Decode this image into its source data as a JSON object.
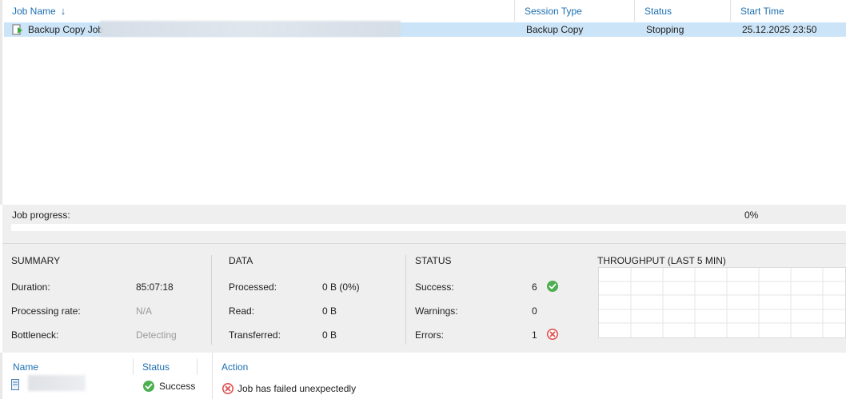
{
  "grid": {
    "columns": {
      "job_name": "Job Name",
      "session_type": "Session Type",
      "status": "Status",
      "start_time": "Start Time"
    },
    "sort_icon": "arrow-down-icon",
    "rows": [
      {
        "icon": "backup-copy-job-icon",
        "job_name": "Backup Copy Job",
        "session_type": "Backup Copy",
        "status": "Stopping",
        "start_time": "25.12.2025 23:50"
      }
    ]
  },
  "progress": {
    "label": "Job progress:",
    "percent_text": "0%",
    "value": 0,
    "color": "#3a9a3a"
  },
  "summary": {
    "title": "SUMMARY",
    "duration_label": "Duration:",
    "duration_value": "85:07:18",
    "rate_label": "Processing rate:",
    "rate_value": "N/A",
    "bottleneck_label": "Bottleneck:",
    "bottleneck_value": "Detecting"
  },
  "data": {
    "title": "DATA",
    "processed_label": "Processed:",
    "processed_value": "0 B (0%)",
    "read_label": "Read:",
    "read_value": "0 B",
    "transferred_label": "Transferred:",
    "transferred_value": "0 B"
  },
  "status": {
    "title": "STATUS",
    "success_label": "Success:",
    "success_value": "6",
    "success_icon": "success-check-icon",
    "warnings_label": "Warnings:",
    "warnings_value": "0",
    "errors_label": "Errors:",
    "errors_value": "1",
    "errors_icon": "error-x-icon",
    "success_color": "#4caf50",
    "error_color": "#e05050"
  },
  "throughput": {
    "title": "THROUGHPUT (LAST 5 MIN)"
  },
  "objects": {
    "name_header": "Name",
    "status_header": "Status",
    "items": [
      {
        "icon": "vm-icon",
        "status": "Success",
        "status_icon": "success-check-icon"
      }
    ]
  },
  "actions": {
    "header": "Action",
    "items": [
      {
        "icon": "error-x-icon",
        "text": "Job has failed unexpectedly"
      }
    ]
  },
  "colors": {
    "accent": "#1c6fb0",
    "selection": "#cce4f7",
    "panel": "#efefef"
  }
}
